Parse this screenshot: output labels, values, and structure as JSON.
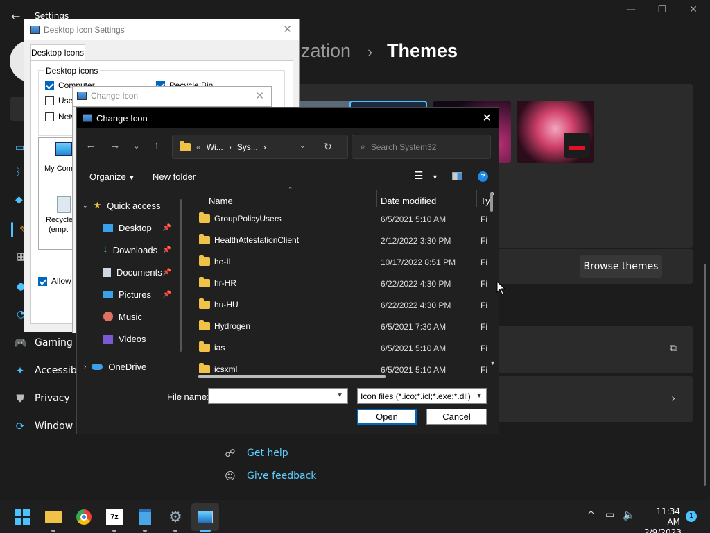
{
  "settings": {
    "window_title": "Settings",
    "breadcrumb_parent": "ization",
    "breadcrumb_sep": "›",
    "breadcrumb_current": "Themes",
    "nav_items": [
      {
        "label": "Gaming",
        "icon": "gaming-icon"
      },
      {
        "label": "Accessib",
        "icon": "accessibility-icon"
      },
      {
        "label": "Privacy",
        "icon": "shield-icon"
      },
      {
        "label": "Window",
        "icon": "windows-update-icon"
      }
    ],
    "browse_themes_label": "Browse themes",
    "links": [
      {
        "label": "Get help",
        "icon": "help-icon"
      },
      {
        "label": "Give feedback",
        "icon": "feedback-icon"
      }
    ],
    "accent": "#4cc2ff"
  },
  "desktop_icon_settings": {
    "title": "Desktop Icon Settings",
    "tab": "Desktop Icons",
    "group_label": "Desktop icons",
    "checkboxes": [
      {
        "label": "Computer",
        "checked": true
      },
      {
        "label": "Recycle Bin",
        "checked": true
      },
      {
        "label": "User",
        "checked": false
      },
      {
        "label": "Netw",
        "checked": false
      }
    ],
    "icon_list": [
      "My Comp",
      "Recycle",
      "(empt"
    ],
    "allow_label": "Allow t"
  },
  "change_icon_back": {
    "title": "Change Icon"
  },
  "dialog": {
    "title": "Change Icon",
    "address": {
      "overflow": "«",
      "crumbs": [
        "Wi...",
        "Sys..."
      ],
      "sep": "›"
    },
    "search_placeholder": "Search System32",
    "organize_label": "Organize",
    "new_folder_label": "New folder",
    "tree": [
      {
        "label": "Quick access",
        "icon": "star-icon",
        "expanded": true
      },
      {
        "label": "Desktop",
        "icon": "desktop-icon",
        "pinned": true
      },
      {
        "label": "Downloads",
        "icon": "downloads-icon",
        "pinned": true
      },
      {
        "label": "Documents",
        "icon": "documents-icon",
        "pinned": true
      },
      {
        "label": "Pictures",
        "icon": "pictures-icon",
        "pinned": true
      },
      {
        "label": "Music",
        "icon": "music-icon",
        "pinned": false
      },
      {
        "label": "Videos",
        "icon": "videos-icon",
        "pinned": false
      },
      {
        "label": "OneDrive",
        "icon": "onedrive-icon",
        "expanded": false
      }
    ],
    "columns": [
      "Name",
      "Date modified",
      "Ty"
    ],
    "rows": [
      {
        "name": "GroupPolicyUsers",
        "date": "6/5/2021 5:10 AM",
        "type": "Fi"
      },
      {
        "name": "HealthAttestationClient",
        "date": "2/12/2022 3:30 PM",
        "type": "Fi"
      },
      {
        "name": "he-IL",
        "date": "10/17/2022 8:51 PM",
        "type": "Fi"
      },
      {
        "name": "hr-HR",
        "date": "6/22/2022 4:30 PM",
        "type": "Fi"
      },
      {
        "name": "hu-HU",
        "date": "6/22/2022 4:30 PM",
        "type": "Fi"
      },
      {
        "name": "Hydrogen",
        "date": "6/5/2021 7:30 AM",
        "type": "Fi"
      },
      {
        "name": "ias",
        "date": "6/5/2021 5:10 AM",
        "type": "Fi"
      },
      {
        "name": "icsxml",
        "date": "6/5/2021 5:10 AM",
        "type": "Fi"
      }
    ],
    "file_name_label": "File name:",
    "file_name_value": "",
    "file_type": "Icon files (*.ico;*.icl;*.exe;*.dll)",
    "open_label": "Open",
    "cancel_label": "Cancel"
  },
  "taskbar": {
    "apps": [
      "start-icon",
      "file-explorer-icon",
      "chrome-icon",
      "7zip-icon",
      "notepad-icon",
      "settings-icon",
      "desktop-icon-settings-icon"
    ],
    "tray": {
      "chevron": "^",
      "time": "11:34 AM",
      "date": "2/9/2023",
      "notifications": "1"
    }
  }
}
